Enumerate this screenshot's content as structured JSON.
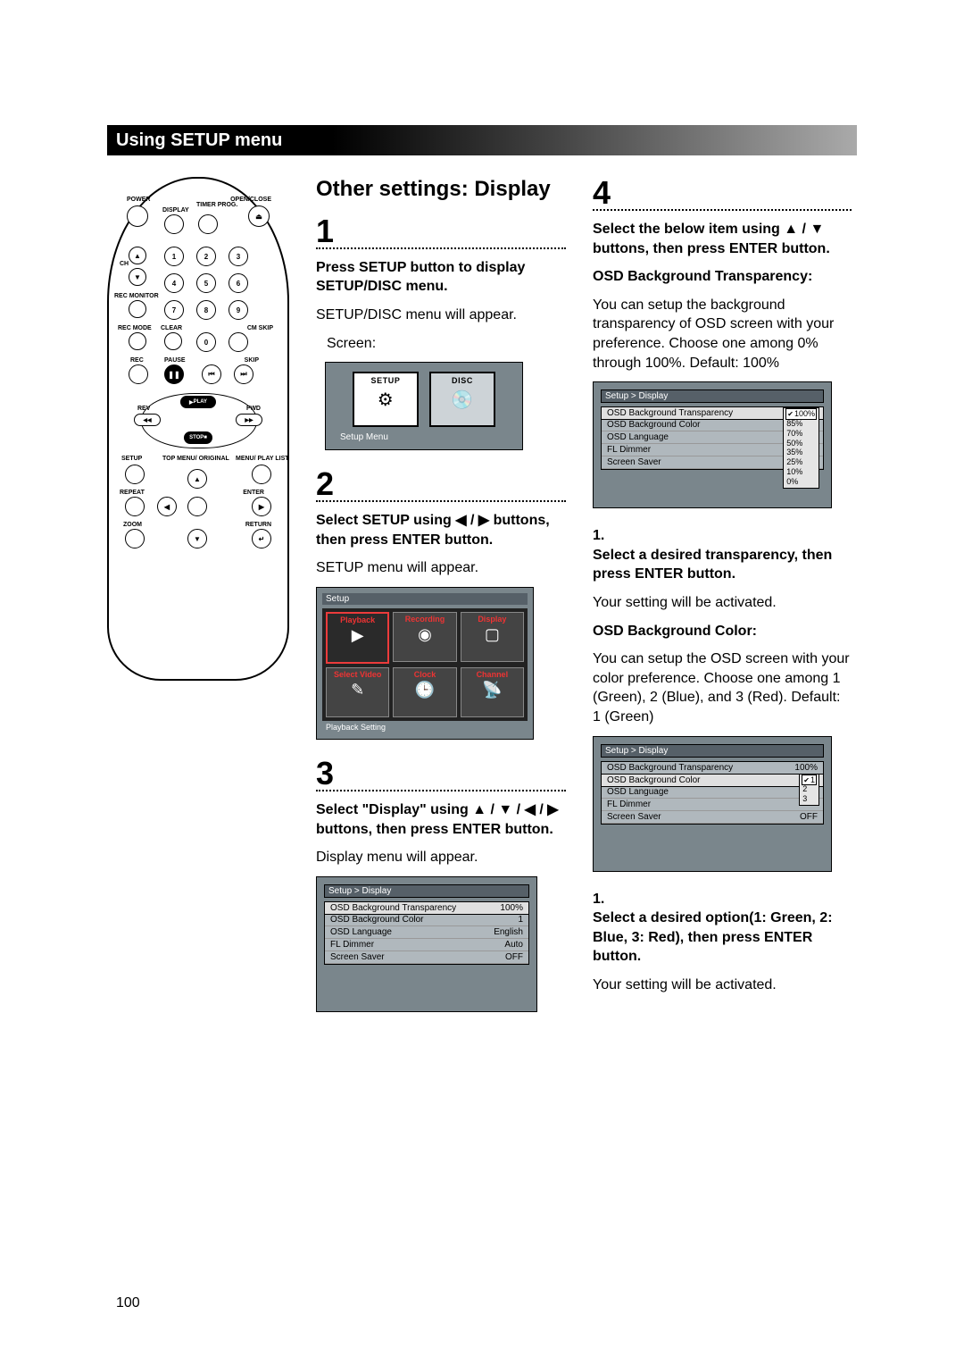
{
  "header": "Using SETUP menu",
  "page_number": "100",
  "section_title": "Other settings: Display",
  "steps": {
    "s1": {
      "num": "1",
      "bold": "Press SETUP button to display SETUP/DISC menu.",
      "text": "SETUP/DISC menu will appear.",
      "screen_label": "Screen:"
    },
    "s2": {
      "num": "2",
      "bold": "Select SETUP using ◀ / ▶ buttons, then press ENTER button.",
      "text": "SETUP menu will appear."
    },
    "s3": {
      "num": "3",
      "bold": "Select \"Display\" using ▲ / ▼ / ◀ / ▶ buttons, then press ENTER button.",
      "text": "Display menu will appear."
    },
    "s4": {
      "num": "4",
      "bold": "Select the below item using ▲ / ▼ buttons, then press ENTER button."
    }
  },
  "osd": {
    "setup_disc": {
      "setup": "SETUP",
      "disc": "DISC",
      "caption": "Setup Menu"
    },
    "grid": {
      "crumb": "Setup",
      "cells": [
        "Playback",
        "Recording",
        "Display",
        "Select Video",
        "Clock",
        "Channel"
      ],
      "footer": "Playback Setting"
    },
    "display_menu": {
      "crumb": "Setup > Display",
      "rows": [
        {
          "k": "OSD Background Transparency",
          "v": "100%"
        },
        {
          "k": "OSD Background Color",
          "v": "1"
        },
        {
          "k": "OSD Language",
          "v": "English"
        },
        {
          "k": "FL Dimmer",
          "v": "Auto"
        },
        {
          "k": "Screen Saver",
          "v": "OFF"
        }
      ]
    },
    "transparency_menu": {
      "crumb": "Setup > Display",
      "rows": [
        {
          "k": "OSD Background Transparency",
          "v": ""
        },
        {
          "k": "OSD Background Color",
          "v": ""
        },
        {
          "k": "OSD Language",
          "v": ""
        },
        {
          "k": "FL Dimmer",
          "v": ""
        },
        {
          "k": "Screen Saver",
          "v": ""
        }
      ],
      "options": [
        "100%",
        "85%",
        "70%",
        "50%",
        "35%",
        "25%",
        "10%",
        "0%"
      ],
      "selected": "100%"
    },
    "color_menu": {
      "crumb": "Setup > Display",
      "rows": [
        {
          "k": "OSD Background Transparency",
          "v": "100%"
        },
        {
          "k": "OSD Background Color",
          "v": ""
        },
        {
          "k": "OSD Language",
          "v": ""
        },
        {
          "k": "FL Dimmer",
          "v": ""
        },
        {
          "k": "Screen Saver",
          "v": "OFF"
        }
      ],
      "options": [
        "1",
        "2",
        "3"
      ],
      "selected": "1"
    }
  },
  "right": {
    "osd_bg_trans_h": "OSD Background Transparency:",
    "osd_bg_trans_t": "You can setup the background transparency of OSD screen with your preference. Choose one among 0% through 100%. Default: 100%",
    "sub1_num": "1.",
    "sub1_bold": "Select a desired transparency, then press ENTER button.",
    "sub1_text": "Your setting will be activated.",
    "osd_bg_color_h": "OSD Background Color:",
    "osd_bg_color_t": "You can setup the OSD screen with your color preference. Choose one among 1 (Green), 2 (Blue), and 3 (Red). Default: 1 (Green)",
    "sub2_num": "1.",
    "sub2_bold": "Select a desired option(1: Green, 2: Blue, 3: Red), then press ENTER button.",
    "sub2_text": "Your setting will be activated."
  },
  "remote": {
    "power": "POWER",
    "openclose": "OPEN/CLOSE",
    "display": "DISPLAY",
    "timer_prog": "TIMER PROG.",
    "ch": "CH",
    "rec_monitor": "REC MONITOR",
    "rec_mode": "REC MODE",
    "clear": "CLEAR",
    "cm_skip": "CM SKIP",
    "rec": "REC",
    "pause": "PAUSE",
    "skip": "SKIP",
    "rev": "REV",
    "play": "PLAY",
    "stop": "STOP",
    "fwd": "FWD",
    "setup": "SETUP",
    "top_menu": "TOP MENU/ ORIGINAL",
    "menu": "MENU/ PLAY LIST",
    "repeat": "REPEAT",
    "enter": "ENTER",
    "zoom": "ZOOM",
    "return": "RETURN",
    "n1": "1",
    "n2": "2",
    "n3": "3",
    "n4": "4",
    "n5": "5",
    "n6": "6",
    "n7": "7",
    "n8": "8",
    "n9": "9",
    "n0": "0"
  }
}
